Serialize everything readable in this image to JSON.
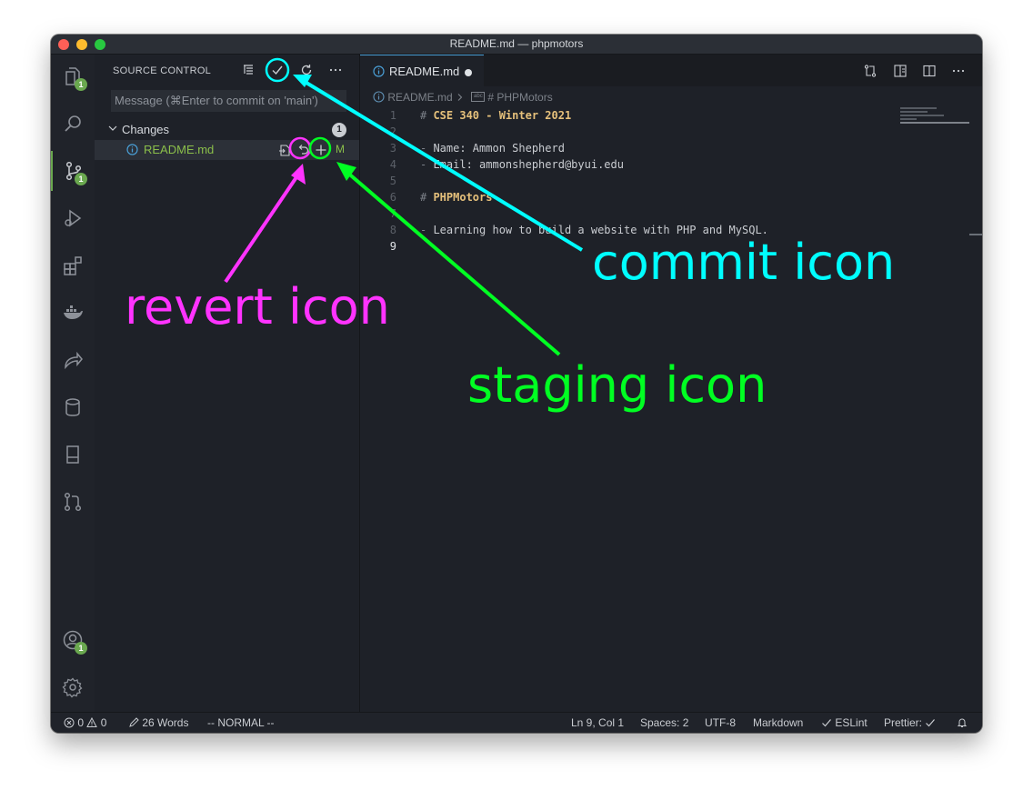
{
  "window": {
    "title": "README.md — phpmotors"
  },
  "activity_bar": {
    "items": [
      {
        "name": "explorer-icon",
        "badge": "1"
      },
      {
        "name": "search-icon",
        "badge": ""
      },
      {
        "name": "source-control-icon",
        "badge": "1"
      },
      {
        "name": "run-debug-icon",
        "badge": ""
      },
      {
        "name": "extensions-icon",
        "badge": ""
      },
      {
        "name": "docker-icon",
        "badge": ""
      },
      {
        "name": "live-share-icon",
        "badge": ""
      },
      {
        "name": "database-icon",
        "badge": ""
      },
      {
        "name": "remote-icon",
        "badge": ""
      },
      {
        "name": "pull-requests-icon",
        "badge": ""
      }
    ],
    "bottom": [
      {
        "name": "accounts-icon",
        "badge": "1"
      },
      {
        "name": "settings-gear-icon",
        "badge": ""
      }
    ]
  },
  "sidebar": {
    "title": "SOURCE CONTROL",
    "message_placeholder": "Message (⌘Enter to commit on 'main')",
    "changes": {
      "label": "Changes",
      "count": "1",
      "files": [
        {
          "name": "README.md",
          "status": "M"
        }
      ]
    }
  },
  "editor": {
    "tab": {
      "name": "README.md"
    },
    "breadcrumb": {
      "file": "README.md",
      "symbol": "# PHPMotors"
    },
    "lines": [
      {
        "num": "1",
        "prefix": "# ",
        "text": "CSE 340 - Winter 2021",
        "kind": "heading"
      },
      {
        "num": "2",
        "prefix": "",
        "text": "",
        "kind": "blank"
      },
      {
        "num": "3",
        "prefix": "- ",
        "text": "Name: Ammon Shepherd",
        "kind": "list"
      },
      {
        "num": "4",
        "prefix": "- ",
        "text": "Email: ammonshepherd@byui.edu",
        "kind": "list"
      },
      {
        "num": "5",
        "prefix": "",
        "text": "",
        "kind": "blank"
      },
      {
        "num": "6",
        "prefix": "# ",
        "text": "PHPMotors",
        "kind": "heading"
      },
      {
        "num": "7",
        "prefix": "",
        "text": "",
        "kind": "blank"
      },
      {
        "num": "8",
        "prefix": "- ",
        "text": "Learning how to build a website with PHP and MySQL.",
        "kind": "list"
      },
      {
        "num": "9",
        "prefix": "",
        "text": "",
        "kind": "blank"
      }
    ]
  },
  "status_bar": {
    "errors": "0",
    "warnings": "0",
    "words": "26 Words",
    "vim_mode": "-- NORMAL --",
    "position": "Ln 9, Col 1",
    "spaces": "Spaces: 2",
    "encoding": "UTF-8",
    "language": "Markdown",
    "eslint": "ESLint",
    "prettier": "Prettier:"
  },
  "annotations": {
    "commit": {
      "text": "commit icon",
      "color": "#00ffff"
    },
    "revert": {
      "text": "revert icon",
      "color": "#ff33ff"
    },
    "staging": {
      "text": "staging icon",
      "color": "#00ff22"
    }
  }
}
